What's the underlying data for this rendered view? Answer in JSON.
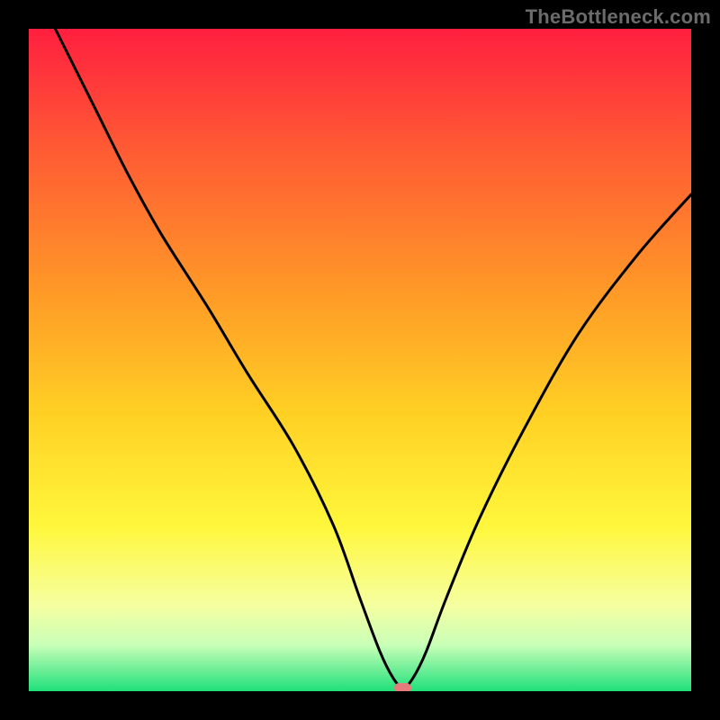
{
  "watermark": {
    "text": "TheBottleneck.com"
  },
  "colors": {
    "top": "#ff1f3f",
    "upper": "#ff5a34",
    "mid1": "#ff9a27",
    "mid2": "#ffd024",
    "lower1": "#fff73b",
    "lower2": "#f6ffa0",
    "lower3": "#c9ffb8",
    "bottom": "#1fe07a",
    "curve": "#000000",
    "marker": "#e77a7d",
    "frame": "#000000"
  },
  "chart_data": {
    "type": "line",
    "title": "",
    "xlabel": "",
    "ylabel": "",
    "xlim": [
      0,
      100
    ],
    "ylim": [
      0,
      100
    ],
    "notes": "V-shaped bottleneck curve over vertical red→green gradient; minimum (optimal point) marked with small rounded rectangle near bottom of valley.",
    "series": [
      {
        "name": "bottleneck-curve",
        "x": [
          4,
          10,
          15,
          20,
          27,
          33,
          40,
          46,
          50,
          53,
          55,
          56.5,
          58,
          60,
          63,
          68,
          75,
          83,
          92,
          100
        ],
        "y": [
          100,
          88,
          78,
          69,
          58,
          48,
          37,
          25,
          14,
          6,
          2,
          0.5,
          2,
          6,
          14,
          26,
          40,
          54,
          66,
          75
        ]
      }
    ],
    "marker": {
      "x": 56.5,
      "y": 0.5,
      "width_pct": 2.6,
      "height_pct": 1.5
    },
    "gradient_stops": [
      {
        "pct": 0,
        "key": "top"
      },
      {
        "pct": 18,
        "key": "upper"
      },
      {
        "pct": 40,
        "key": "mid1"
      },
      {
        "pct": 58,
        "key": "mid2"
      },
      {
        "pct": 75,
        "key": "lower1"
      },
      {
        "pct": 87,
        "key": "lower2"
      },
      {
        "pct": 93,
        "key": "lower3"
      },
      {
        "pct": 100,
        "key": "bottom"
      }
    ]
  }
}
